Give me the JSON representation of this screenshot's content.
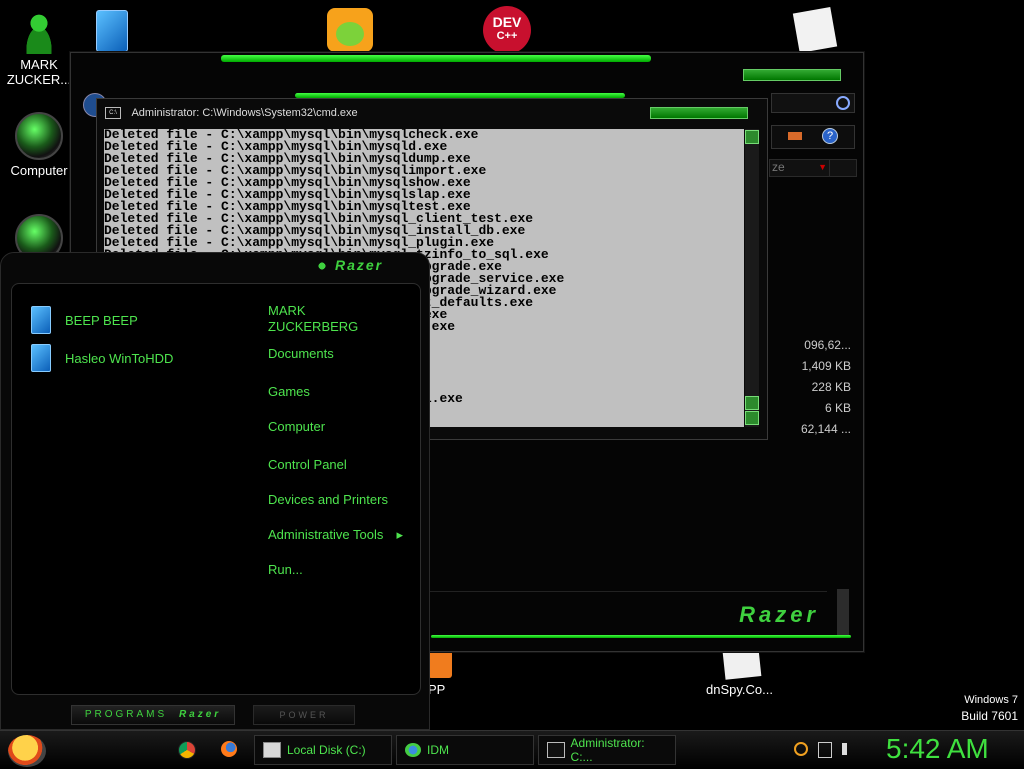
{
  "desktop": {
    "icons": [
      {
        "label": "MARK ZUCKER..."
      },
      {
        "label": "Computer"
      },
      {
        "label": "PP"
      },
      {
        "label": "dnSpy.Co..."
      }
    ],
    "os_name": "Windows 7",
    "build": "Build 7601"
  },
  "dev_icon": {
    "line1": "DEV",
    "line2": "C++"
  },
  "explorer": {
    "sort_label": "ze",
    "sizes": [
      "096,62...",
      "1,409 KB",
      "228 KB",
      "6 KB",
      "62,144 ..."
    ],
    "brand": "Razer"
  },
  "cmd": {
    "title": "Administrator: C:\\Windows\\System32\\cmd.exe",
    "icon_text": "C:\\",
    "lines": [
      "Deleted file - C:\\xampp\\mysql\\bin\\mysqlcheck.exe",
      "Deleted file - C:\\xampp\\mysql\\bin\\mysqld.exe",
      "Deleted file - C:\\xampp\\mysql\\bin\\mysqldump.exe",
      "Deleted file - C:\\xampp\\mysql\\bin\\mysqlimport.exe",
      "Deleted file - C:\\xampp\\mysql\\bin\\mysqlshow.exe",
      "Deleted file - C:\\xampp\\mysql\\bin\\mysqlslap.exe",
      "Deleted file - C:\\xampp\\mysql\\bin\\mysqltest.exe",
      "Deleted file - C:\\xampp\\mysql\\bin\\mysql_client_test.exe",
      "Deleted file - C:\\xampp\\mysql\\bin\\mysql_install_db.exe",
      "Deleted file - C:\\xampp\\mysql\\bin\\mysql_plugin.exe",
      "Deleted file - C:\\xampp\\mysql\\bin\\mysql_tzinfo_to_sql.exe",
      "Deleted file - C:\\xampp\\mysql\\bin\\mysql_upgrade.exe",
      "Deleted file - C:\\xampp\\mysql\\bin\\mysql_upgrade_service.exe",
      "Deleted file - C:\\xampp\\mysql\\bin\\mysql_upgrade_wizard.exe",
      "Deleted file - C:\\xampp\\mysql\\bin\\my_print_defaults.exe",
      "Deleted file - C:\\xampp\\mysql\\bin\\perror.exe",
      "Deleted file - C:\\xampp\\mysql\\bin\\replace.exe",
      "",
      "",
      "",
      "",
      "",
      "Deleted file - C:\\xampp\\apache\\bin\\openssl.exe"
    ]
  },
  "start_menu": {
    "brand": "Razer",
    "programs": [
      {
        "label": "BEEP BEEP"
      },
      {
        "label": "Hasleo WinToHDD"
      }
    ],
    "right": {
      "user_line1": "MARK",
      "user_line2": "ZUCKERBERG",
      "items": [
        "Documents",
        "Games",
        "Computer",
        "Control Panel",
        "Devices and Printers",
        "Administrative Tools",
        "Run..."
      ]
    },
    "arrow": "▸",
    "programs_label": "PROGRAMS",
    "power_label": "POWER"
  },
  "taskbar": {
    "tasks": [
      {
        "label": "Local Disk (C:)"
      },
      {
        "label": "IDM"
      },
      {
        "label": "Administrator: C:..."
      }
    ],
    "clock": "5:42 AM"
  },
  "colors": {
    "accent": "#4ee44e",
    "background": "#000000"
  }
}
